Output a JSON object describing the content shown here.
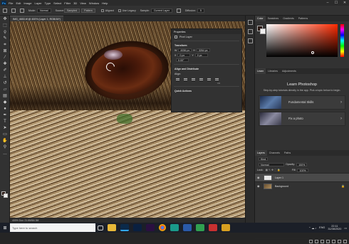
{
  "menubar": {
    "logo": "Ps",
    "items": [
      "File",
      "Edit",
      "Image",
      "Layer",
      "Type",
      "Select",
      "Filter",
      "3D",
      "View",
      "Window",
      "Help"
    ],
    "controls": [
      "–",
      "☐",
      "✕"
    ]
  },
  "options": {
    "mode_label": "Mode:",
    "mode_value": "Normal",
    "source_label": "Source:",
    "sampled": "Sampled",
    "pattern": "Pattern",
    "aligned": "Aligned",
    "use_legacy": "Use Legacy",
    "sample_label": "Sample:",
    "sample_value": "Current Layer",
    "diffusion_label": "Diffusion:",
    "diffusion_value": "5"
  },
  "document": {
    "tab_title": "IMG_4653.tif @ 400% (Layer 1, RGB/16*)",
    "status": "400%     Doc: 21.6M/84.3M"
  },
  "properties": {
    "title": "Properties",
    "layer_type": "Pixel Layer",
    "transform": "Transform",
    "w_label": "W",
    "w_value": "4936 px",
    "h_label": "H",
    "h_value": "3264 px",
    "x_label": "X",
    "x_value": "0 px",
    "y_label": "Y",
    "y_value": "0 px",
    "angle_value": "0.00°",
    "align": "Align and Distribute",
    "align_sub": "Align:",
    "quick_actions": "Quick Actions",
    "more": "•••"
  },
  "color_panel": {
    "tabs": [
      "Color",
      "Swatches",
      "Gradients",
      "Patterns"
    ]
  },
  "learn_panel": {
    "tabs": [
      "Learn",
      "Libraries",
      "Adjustments"
    ],
    "title": "Learn Photoshop",
    "desc": "Step-by-step tutorials directly in the app. Pick a topic below to begin.",
    "cards": [
      {
        "title": "Fundamental Skills"
      },
      {
        "title": "Fix a photo"
      }
    ]
  },
  "layers_panel": {
    "tabs": [
      "Layers",
      "Channels",
      "Paths"
    ],
    "kind_label": "Kind",
    "blend_mode": "Normal",
    "opacity_label": "Opacity:",
    "opacity_value": "100%",
    "lock_label": "Lock:",
    "fill_label": "Fill:",
    "fill_value": "100%",
    "layers": [
      {
        "name": "Layer 1",
        "selected": true
      },
      {
        "name": "Background",
        "selected": false
      }
    ]
  },
  "taskbar": {
    "search_placeholder": "Type here to search",
    "lang": "ENG",
    "time": "22:11",
    "date": "31/08/2020"
  }
}
